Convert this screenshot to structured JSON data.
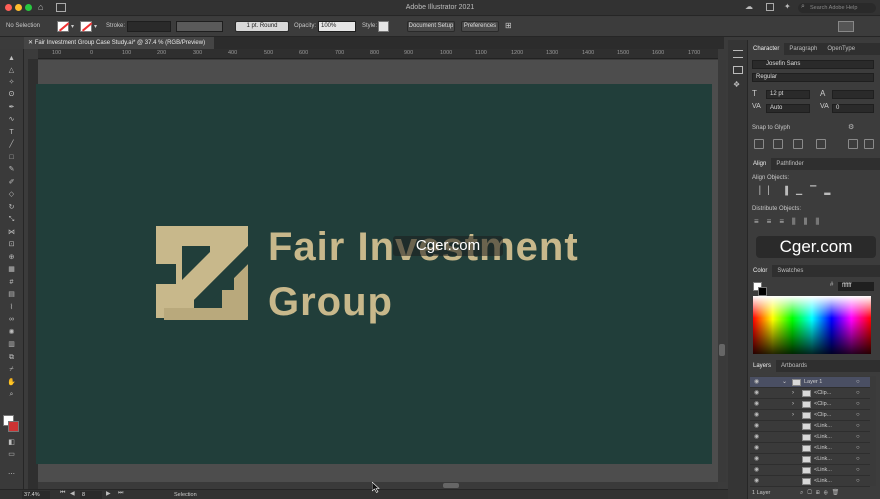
{
  "app": {
    "title": "Adobe Illustrator 2021",
    "search_placeholder": "Search Adobe Help"
  },
  "control_bar": {
    "selection_label": "No Selection",
    "stroke_label": "Stroke:",
    "brush_value": "1 pt. Round",
    "opacity_label": "Opacity:",
    "opacity_value": "100%",
    "style_label": "Style:",
    "document_setup_label": "Document Setup",
    "preferences_label": "Preferences"
  },
  "document": {
    "tab_title": "Fair Investment Group Case Study.ai* @ 37.4 % (RGB/Preview)",
    "zoom": "37.4%",
    "artboard_number": "8",
    "status_tool": "Selection",
    "ruler_ticks": [
      "100",
      "0",
      "100",
      "200",
      "300",
      "400",
      "500",
      "600",
      "700",
      "800",
      "900",
      "1000",
      "1100",
      "1200",
      "1300",
      "1400",
      "1500",
      "1600",
      "1700"
    ]
  },
  "artwork": {
    "line1": "Fair Investment",
    "line2": "Group",
    "background_color": "#213e3a",
    "gold_color": "#c8b88b"
  },
  "watermark": {
    "text_center": "Cger.com",
    "text_right": "Cger.com"
  },
  "character_panel": {
    "tabs": [
      "Character",
      "Paragraph",
      "OpenType"
    ],
    "font_family": "Josefin Sans",
    "font_style": "Regular",
    "font_size": "12 pt",
    "leading": "",
    "kerning": "Auto",
    "tracking": "0",
    "snap_to_glyph_label": "Snap to Glyph"
  },
  "align_panel": {
    "tabs": [
      "Align",
      "Pathfinder"
    ],
    "align_objects_label": "Align Objects:",
    "distribute_objects_label": "Distribute Objects:"
  },
  "color_panel": {
    "tabs": [
      "Color",
      "Swatches"
    ],
    "hex_value": "ffffff"
  },
  "layers_panel": {
    "tabs": [
      "Layers",
      "Artboards"
    ],
    "rows": [
      "Layer 1",
      "<Clip...",
      "<Clip...",
      "<Clip...",
      "<Link...",
      "<Link...",
      "<Link...",
      "<Link...",
      "<Link...",
      "<Link..."
    ],
    "footer": "1 Layer"
  }
}
